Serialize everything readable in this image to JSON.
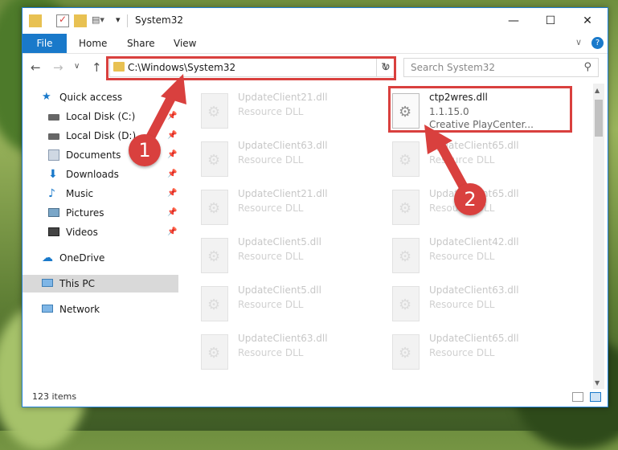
{
  "window": {
    "title": "System32"
  },
  "ribbon": {
    "file": "File",
    "tabs": [
      "Home",
      "Share",
      "View"
    ]
  },
  "nav": {
    "address": "C:\\Windows\\System32",
    "search_placeholder": "Search System32"
  },
  "sidebar": {
    "items": [
      {
        "label": "Quick access",
        "icon": "star-icon",
        "pinned": false
      },
      {
        "label": "Local Disk (C:)",
        "icon": "drive-icon",
        "pinned": true
      },
      {
        "label": "Local Disk (D:)",
        "icon": "drive-icon",
        "pinned": true
      },
      {
        "label": "Documents",
        "icon": "documents-icon",
        "pinned": true
      },
      {
        "label": "Downloads",
        "icon": "downloads-icon",
        "pinned": true
      },
      {
        "label": "Music",
        "icon": "music-icon",
        "pinned": true
      },
      {
        "label": "Pictures",
        "icon": "pictures-icon",
        "pinned": true
      },
      {
        "label": "Videos",
        "icon": "videos-icon",
        "pinned": true
      },
      {
        "label": "OneDrive",
        "icon": "cloud-icon",
        "pinned": false
      },
      {
        "label": "This PC",
        "icon": "computer-icon",
        "pinned": false
      },
      {
        "label": "Network",
        "icon": "network-icon",
        "pinned": false
      }
    ]
  },
  "files": [
    {
      "name": "UpdateClient21.dll",
      "type": "Resource DLL"
    },
    {
      "name": "ctp2wres.dll",
      "version": "1.1.15.0",
      "company": "Creative PlayCenter..."
    },
    {
      "name": "UpdateClient63.dll",
      "type": "Resource DLL"
    },
    {
      "name": "UpdateClient65.dll",
      "type": "Resource DLL"
    },
    {
      "name": "UpdateClient21.dll",
      "type": "Resource DLL"
    },
    {
      "name": "UpdateClient65.dll",
      "type": "Resource DLL"
    },
    {
      "name": "UpdateClient5.dll",
      "type": "Resource DLL"
    },
    {
      "name": "UpdateClient42.dll",
      "type": "Resource DLL"
    },
    {
      "name": "UpdateClient5.dll",
      "type": "Resource DLL"
    },
    {
      "name": "UpdateClient63.dll",
      "type": "Resource DLL"
    },
    {
      "name": "UpdateClient63.dll",
      "type": "Resource DLL"
    },
    {
      "name": "UpdateClient65.dll",
      "type": "Resource DLL"
    }
  ],
  "status": {
    "items": "123 items"
  },
  "annotations": {
    "step1": "1",
    "step2": "2"
  },
  "colors": {
    "accent": "#1979ca",
    "highlight": "#d9403e"
  }
}
